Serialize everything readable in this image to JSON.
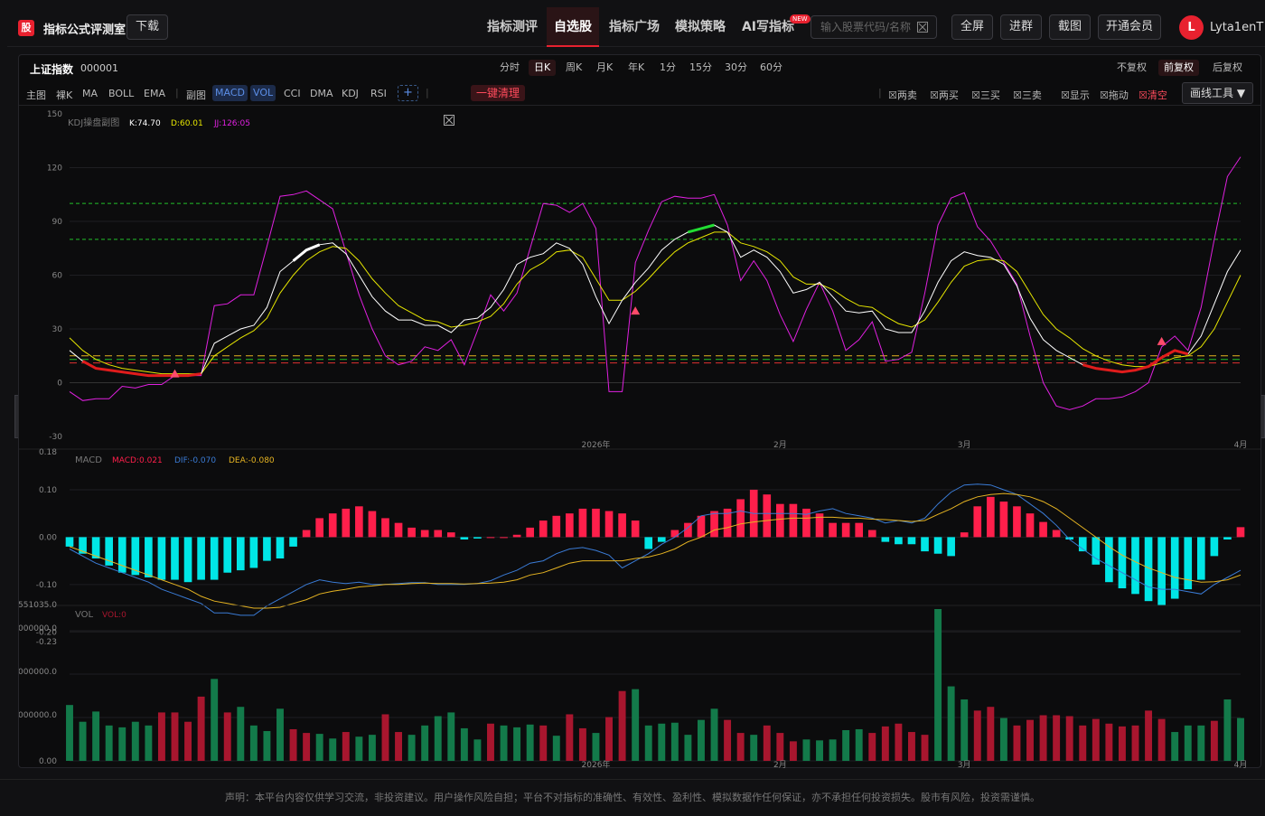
{
  "header": {
    "logo_char": "股",
    "brand": "指标公式评测室",
    "download": "下载",
    "nav": [
      "指标测评",
      "自选股",
      "指标广场",
      "模拟策略",
      "AI写指标"
    ],
    "nav_active": 1,
    "new_tag": "NEW",
    "search_placeholder": "输入股票代码/名称",
    "buttons": [
      "全屏",
      "进群",
      "截图",
      "开通会员"
    ],
    "avatar": "L",
    "username": "Lyta1enT"
  },
  "stock": {
    "name": "上证指数",
    "code": "000001",
    "periods": [
      "分时",
      "日K",
      "周K",
      "月K",
      "年K",
      "1分",
      "15分",
      "30分",
      "60分"
    ],
    "period_active": 1,
    "adjust": [
      "不复权",
      "前复权",
      "后复权"
    ],
    "adjust_active": 1
  },
  "toolbar": {
    "main_label": "主图",
    "main_items": [
      "裸K",
      "MA",
      "BOLL",
      "EMA"
    ],
    "sub_label": "副图",
    "sub_items": [
      "MACD",
      "VOL",
      "CCI",
      "DMA",
      "KDJ",
      "RSI"
    ],
    "sub_active": [
      "MACD",
      "VOL"
    ],
    "add": "+",
    "clear": "一键清理",
    "signals": [
      "两卖",
      "两买",
      "三买",
      "三卖",
      "显示",
      "拖动",
      "清空"
    ],
    "draw_tools": "画线工具 ▼"
  },
  "colors": {
    "k": "#ffffff",
    "d": "#e6e600",
    "j": "#e020e0",
    "up": "#ff1f4b",
    "down": "#00e6e6",
    "dif": "#3a7bd5",
    "dea": "#e6b422",
    "vol_up": "#a8162e",
    "vol_down": "#137a4a",
    "accent": "#e8212f"
  },
  "chart_data": [
    {
      "type": "line",
      "name": "KDJ",
      "title": "KDJ操盘副图",
      "readout": {
        "K": "K:74.70",
        "D": "D:60.01",
        "J": "JJ:126:05"
      },
      "ylim": [
        -30,
        150
      ],
      "yticks": [
        -30,
        0,
        30,
        60,
        90,
        120,
        150
      ],
      "xticks": [
        {
          "i": 40,
          "label": "2026年"
        },
        {
          "i": 54,
          "label": "2月"
        },
        {
          "i": 68,
          "label": "3月"
        },
        {
          "i": 89,
          "label": "4月"
        }
      ],
      "n": 90,
      "reference_lines": [
        100,
        80,
        15,
        11
      ],
      "K": [
        18,
        12,
        8,
        7,
        6,
        5,
        4,
        4,
        4,
        4,
        5,
        22,
        26,
        30,
        32,
        42,
        62,
        68,
        74,
        77,
        78,
        72,
        60,
        48,
        40,
        35,
        35,
        32,
        32,
        28,
        35,
        36,
        42,
        52,
        66,
        70,
        72,
        78,
        75,
        66,
        48,
        33,
        46,
        56,
        64,
        74,
        80,
        84,
        86,
        88,
        84,
        70,
        74,
        70,
        62,
        50,
        52,
        56,
        48,
        40,
        39,
        40,
        30,
        28,
        28,
        40,
        56,
        68,
        73,
        71,
        70,
        66,
        54,
        36,
        24,
        18,
        14,
        10,
        8,
        7,
        6,
        7,
        9,
        14,
        18,
        16,
        26,
        44,
        62,
        74
      ],
      "D": [
        25,
        18,
        13,
        10,
        8,
        7,
        6,
        5,
        5,
        5,
        5,
        15,
        20,
        25,
        29,
        36,
        50,
        60,
        68,
        73,
        76,
        75,
        68,
        58,
        50,
        43,
        39,
        35,
        34,
        31,
        32,
        34,
        37,
        44,
        55,
        63,
        67,
        73,
        74,
        70,
        58,
        46,
        46,
        51,
        58,
        66,
        73,
        78,
        81,
        84,
        84,
        78,
        76,
        73,
        68,
        59,
        55,
        55,
        52,
        47,
        43,
        42,
        37,
        33,
        31,
        35,
        45,
        56,
        65,
        68,
        69,
        68,
        62,
        50,
        38,
        30,
        25,
        19,
        15,
        12,
        10,
        9,
        9,
        11,
        14,
        15,
        20,
        30,
        45,
        60
      ],
      "J": [
        -5,
        -10,
        -9,
        -9,
        -2,
        -3,
        -1,
        -1,
        4,
        4,
        4,
        43,
        44,
        49,
        49,
        76,
        104,
        105,
        107,
        102,
        97,
        73,
        49,
        30,
        15,
        10,
        12,
        20,
        18,
        24,
        10,
        29,
        49,
        40,
        50,
        75,
        100,
        99,
        95,
        100,
        86,
        -5,
        -5,
        67,
        85,
        101,
        104,
        103,
        103,
        105,
        88,
        57,
        68,
        57,
        38,
        23,
        41,
        56,
        40,
        18,
        24,
        34,
        12,
        13,
        17,
        50,
        88,
        103,
        106,
        87,
        79,
        67,
        55,
        26,
        0,
        -13,
        -15,
        -13,
        -9,
        -9,
        -8,
        -5,
        0,
        20,
        26,
        18,
        42,
        80,
        115,
        126
      ]
    },
    {
      "type": "bar",
      "name": "MACD",
      "title": "MACD",
      "readout": {
        "MACD": "MACD:0.021",
        "DIF": "DIF:-0.070",
        "DEA": "DEA:-0.080"
      },
      "ylim": [
        -0.23,
        0.18
      ],
      "yticks": [
        -0.2,
        -0.1,
        0.0,
        0.1
      ],
      "ytick_labels": [
        "-0.20",
        "-0.10",
        "0.00",
        "0.10"
      ],
      "extra_ytick_labels": [
        "0.18",
        "-0.23"
      ],
      "n": 90,
      "MACD": [
        -0.02,
        -0.035,
        -0.045,
        -0.06,
        -0.075,
        -0.08,
        -0.085,
        -0.09,
        -0.09,
        -0.095,
        -0.09,
        -0.09,
        -0.075,
        -0.07,
        -0.065,
        -0.05,
        -0.045,
        -0.02,
        0.015,
        0.04,
        0.05,
        0.06,
        0.065,
        0.055,
        0.04,
        0.03,
        0.02,
        0.015,
        0.015,
        0.01,
        -0.005,
        -0.003,
        0.0,
        0.0,
        0.005,
        0.02,
        0.035,
        0.045,
        0.05,
        0.06,
        0.06,
        0.055,
        0.05,
        0.035,
        -0.025,
        -0.01,
        0.015,
        0.03,
        0.045,
        0.055,
        0.06,
        0.08,
        0.1,
        0.09,
        0.07,
        0.07,
        0.06,
        0.05,
        0.03,
        0.03,
        0.03,
        0.015,
        -0.01,
        -0.015,
        -0.015,
        -0.03,
        -0.035,
        -0.04,
        0.01,
        0.065,
        0.085,
        0.075,
        0.065,
        0.05,
        0.032,
        0.015,
        -0.005,
        -0.03,
        -0.058,
        -0.095,
        -0.108,
        -0.12,
        -0.135,
        -0.145,
        -0.13,
        -0.11,
        -0.09,
        -0.04,
        -0.005,
        0.021
      ],
      "DIF": [
        -0.025,
        -0.04,
        -0.055,
        -0.065,
        -0.075,
        -0.085,
        -0.095,
        -0.11,
        -0.12,
        -0.13,
        -0.14,
        -0.16,
        -0.16,
        -0.165,
        -0.165,
        -0.145,
        -0.13,
        -0.115,
        -0.1,
        -0.09,
        -0.095,
        -0.098,
        -0.095,
        -0.1,
        -0.1,
        -0.098,
        -0.096,
        -0.096,
        -0.1,
        -0.1,
        -0.1,
        -0.098,
        -0.092,
        -0.08,
        -0.07,
        -0.055,
        -0.05,
        -0.035,
        -0.025,
        -0.022,
        -0.028,
        -0.038,
        -0.065,
        -0.05,
        -0.035,
        -0.015,
        0.0,
        0.02,
        0.045,
        0.05,
        0.05,
        0.055,
        0.05,
        0.05,
        0.05,
        0.05,
        0.048,
        0.055,
        0.06,
        0.05,
        0.045,
        0.04,
        0.03,
        0.035,
        0.03,
        0.04,
        0.07,
        0.095,
        0.11,
        0.112,
        0.11,
        0.1,
        0.09,
        0.07,
        0.05,
        0.025,
        -0.005,
        -0.025,
        -0.045,
        -0.06,
        -0.075,
        -0.09,
        -0.105,
        -0.11,
        -0.11,
        -0.115,
        -0.12,
        -0.1,
        -0.085,
        -0.07
      ],
      "DEA": [
        -0.02,
        -0.03,
        -0.04,
        -0.05,
        -0.06,
        -0.07,
        -0.08,
        -0.09,
        -0.1,
        -0.11,
        -0.125,
        -0.135,
        -0.14,
        -0.145,
        -0.15,
        -0.15,
        -0.148,
        -0.14,
        -0.132,
        -0.12,
        -0.114,
        -0.11,
        -0.105,
        -0.103,
        -0.1,
        -0.1,
        -0.098,
        -0.097,
        -0.098,
        -0.098,
        -0.099,
        -0.098,
        -0.097,
        -0.095,
        -0.09,
        -0.08,
        -0.075,
        -0.065,
        -0.055,
        -0.05,
        -0.05,
        -0.05,
        -0.05,
        -0.045,
        -0.042,
        -0.035,
        -0.025,
        -0.01,
        0.0,
        0.015,
        0.02,
        0.028,
        0.032,
        0.035,
        0.038,
        0.04,
        0.04,
        0.042,
        0.042,
        0.04,
        0.04,
        0.038,
        0.037,
        0.035,
        0.033,
        0.035,
        0.048,
        0.06,
        0.075,
        0.085,
        0.09,
        0.092,
        0.09,
        0.085,
        0.075,
        0.06,
        0.04,
        0.02,
        0.0,
        -0.02,
        -0.038,
        -0.052,
        -0.065,
        -0.075,
        -0.085,
        -0.09,
        -0.095,
        -0.094,
        -0.09,
        -0.08
      ]
    },
    {
      "type": "bar",
      "name": "VOL",
      "title": "VOL",
      "readout": {
        "VOL": "VOL:0"
      },
      "ylim": [
        0,
        551035
      ],
      "yticks_labels": [
        "551035.0",
        "000000.0",
        "000000.0",
        "000000.0",
        "0.00"
      ],
      "n": 90,
      "values": [
        60,
        42,
        53,
        38,
        36,
        42,
        38,
        52,
        52,
        42,
        69,
        88,
        52,
        58,
        38,
        32,
        56,
        34,
        30,
        29,
        24,
        31,
        26,
        28,
        50,
        31,
        28,
        38,
        48,
        52,
        35,
        23,
        40,
        38,
        36,
        39,
        38,
        27,
        50,
        35,
        30,
        47,
        75,
        77,
        38,
        40,
        41,
        28,
        44,
        56,
        44,
        30,
        28,
        38,
        30,
        21,
        23,
        22,
        23,
        33,
        34,
        30,
        37,
        40,
        31,
        28,
        163,
        80,
        66,
        54,
        58,
        46,
        38,
        44,
        49,
        49,
        48,
        38,
        45,
        40,
        37,
        38,
        54,
        45,
        31,
        38,
        38,
        43,
        66,
        46
      ],
      "up": [
        1,
        1,
        1,
        1,
        1,
        1,
        1,
        0,
        0,
        0,
        0,
        1,
        0,
        1,
        1,
        1,
        1,
        0,
        0,
        1,
        1,
        0,
        1,
        1,
        0,
        0,
        1,
        1,
        1,
        1,
        1,
        1,
        0,
        1,
        1,
        1,
        0,
        1,
        0,
        0,
        1,
        0,
        0,
        1,
        1,
        1,
        1,
        1,
        1,
        1,
        0,
        0,
        1,
        0,
        0,
        0,
        1,
        1,
        1,
        1,
        1,
        0,
        0,
        0,
        0,
        0,
        1,
        1,
        1,
        0,
        0,
        1,
        0,
        0,
        0,
        0,
        0,
        0,
        0,
        0,
        0,
        0,
        0,
        0,
        1,
        1,
        1,
        0,
        1,
        1
      ]
    }
  ],
  "footer": "声明：本平台内容仅供学习交流，非投资建议。用户操作风险自担；平台不对指标的准确性、有效性、盈利性、模拟数据作任何保证，亦不承担任何投资损失。股市有风险，投资需谨慎。"
}
